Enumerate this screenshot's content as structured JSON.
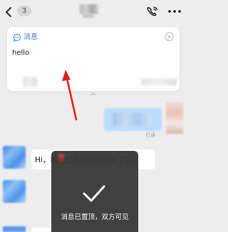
{
  "header": {
    "unread_count": "3",
    "back_icon": "chevron-left-icon",
    "call_icon": "phone-call-icon",
    "more_icon": "more-dots-icon"
  },
  "pinned_message": {
    "label": "消息",
    "text": "hello",
    "icon": "chat-bubble-icon",
    "close_icon": "close-circle-icon"
  },
  "messages": {
    "outgoing_status": "已读",
    "incoming_text": "Hi，我通过你的好友请求了"
  },
  "toast": {
    "text": "消息已置顶，双方可见",
    "icon": "checkmark-icon"
  },
  "colors": {
    "background": "#ededed",
    "accent_blue": "#4b7fd1",
    "annotation_red": "#e8201a",
    "outgoing_bubble": "#bcdcfb",
    "toast_bg": "#383838"
  }
}
